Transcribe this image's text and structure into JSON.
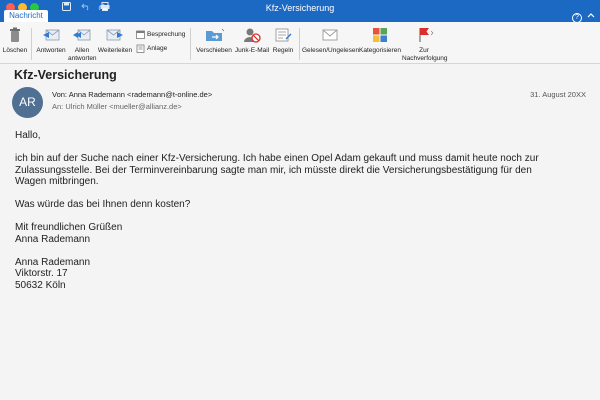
{
  "window": {
    "title": "Kfz-Versicherung"
  },
  "ribbon": {
    "active_tab": "Nachricht",
    "help_glyph": "?"
  },
  "toolbar": {
    "delete": "Löschen",
    "reply": "Antworten",
    "reply_all_line1": "Allen",
    "reply_all_line2": "antworten",
    "forward": "Weiterleiten",
    "meeting": "Besprechung",
    "attachment": "Anlage",
    "move": "Verschieben",
    "junk": "Junk-E-Mail",
    "rules": "Regeln",
    "read_unread": "Gelesen/Ungelesen",
    "categorize": "Kategorisieren",
    "followup_line1": "Zur",
    "followup_line2": "Nachverfolgung"
  },
  "message": {
    "subject": "Kfz-Versicherung",
    "avatar_initials": "AR",
    "from_label": "Von:",
    "from": "Anna Rademann <rademann@t-online.de>",
    "to_label": "An:",
    "to": "Ulrich Müller <mueller@allianz.de>",
    "date": "31. August 20XX",
    "body": {
      "greeting": "Hallo,",
      "p1_line1": "ich bin auf der Suche nach einer Kfz-Versicherung. Ich habe einen Opel Adam gekauft und muss damit heute noch zur",
      "p1_line2": "Zulassungsstelle. Bei der Terminvereinbarung sagte man mir, ich müsste direkt die Versicherungsbestätigung für den",
      "p1_line3": "Wagen mitbringen.",
      "p2": "Was würde das bei Ihnen denn kosten?",
      "closing": "Mit freundlichen Grüßen",
      "closing_name": "Anna Rademann",
      "sig_name": "Anna Rademann",
      "sig_street": "Viktorstr. 17",
      "sig_city": "50632 Köln"
    }
  },
  "icons": {
    "save": "save-icon",
    "undo": "undo-icon",
    "redo": "redo-icon",
    "print": "print-icon"
  },
  "colors": {
    "accent": "#1c69c4",
    "avatar": "#4f6f93",
    "flag": "#d9302c"
  }
}
